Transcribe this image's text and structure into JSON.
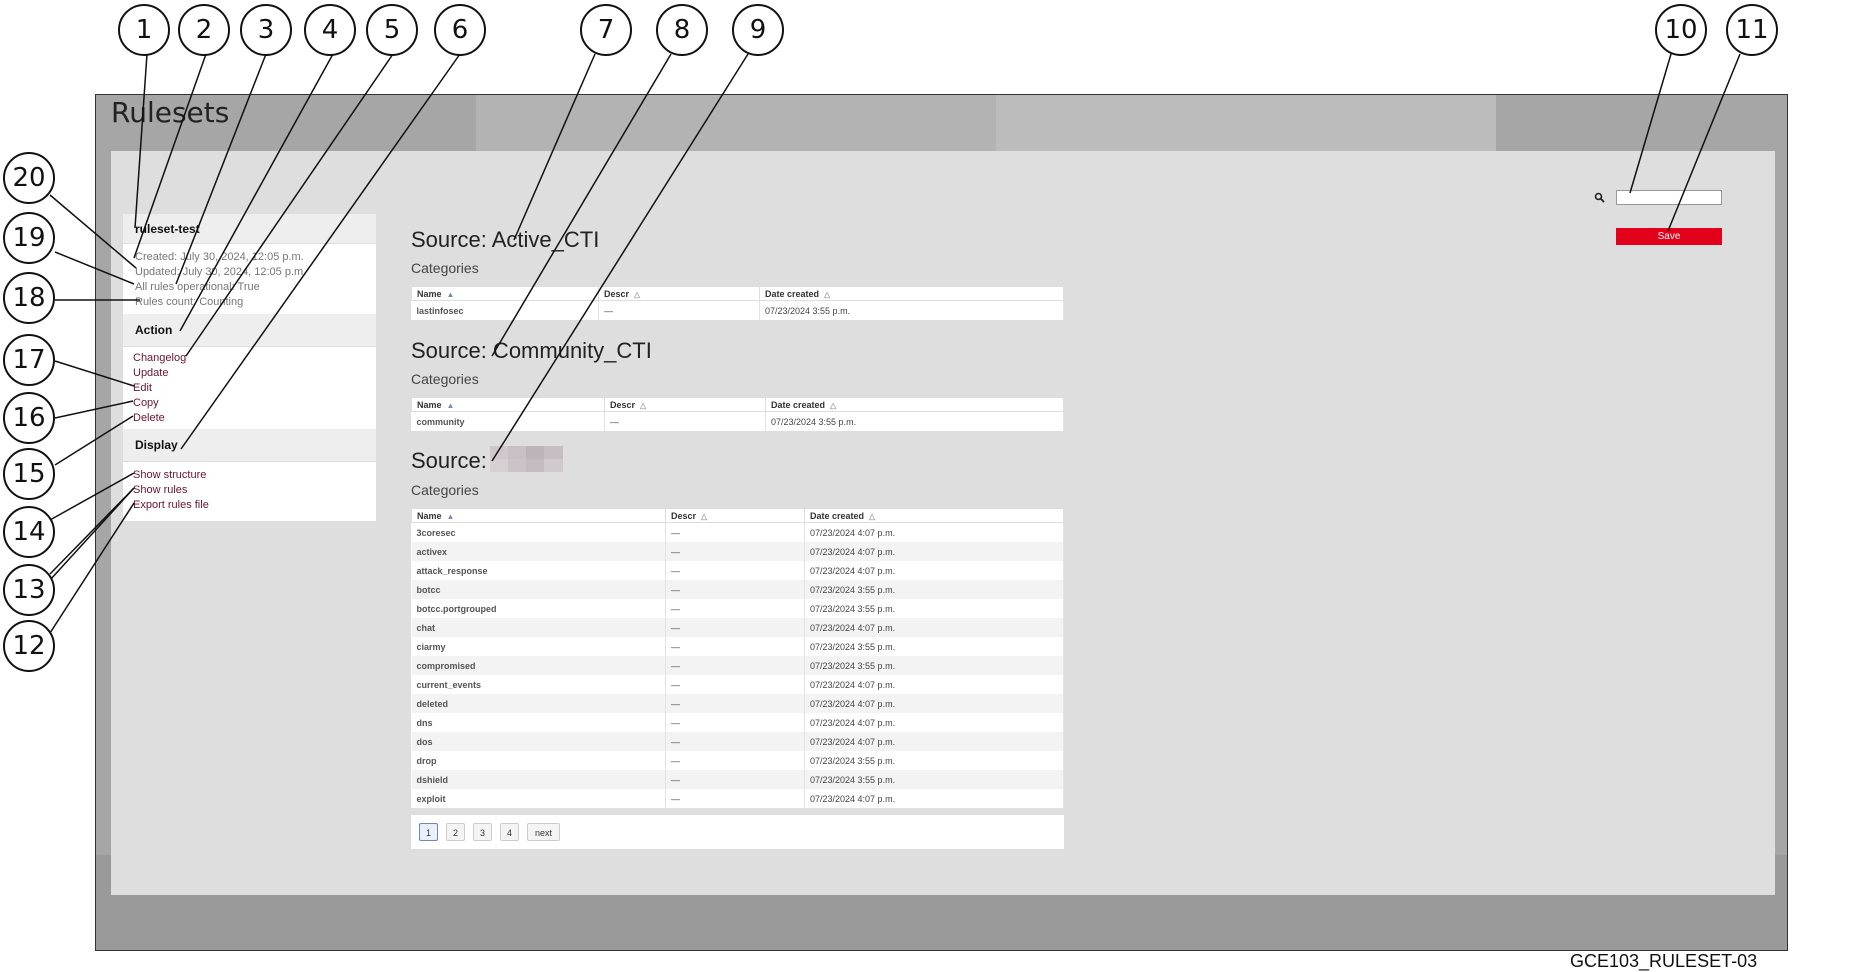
{
  "page_title": "Rulesets",
  "document_id": "GCE103_RULESET-03",
  "callouts": [
    "1",
    "2",
    "3",
    "4",
    "5",
    "6",
    "7",
    "8",
    "9",
    "10",
    "11",
    "20",
    "19",
    "18",
    "17",
    "16",
    "15",
    "14",
    "13",
    "12"
  ],
  "sidebar": {
    "ruleset_name": "ruleset-test",
    "created": "Created: July 30, 2024, 12:05 p.m.",
    "updated": "Updated: July 30, 2024, 12:05 p.m.",
    "operational": "All rules operational: True",
    "rules_count": "Rules count: Counting",
    "action_header": "Action",
    "actions": [
      "Changelog",
      "Update",
      "Edit",
      "Copy",
      "Delete"
    ],
    "display_header": "Display",
    "display_links": [
      "Show structure",
      "Show rules",
      "Export rules file"
    ]
  },
  "search": {
    "placeholder": ""
  },
  "save_label": "Save",
  "columns": [
    "Name",
    "Descr",
    "Date created"
  ],
  "categories_label": "Categories",
  "sources": [
    {
      "title": "Source: Active_CTI",
      "rows": [
        {
          "name": "lastinfosec",
          "descr": "—",
          "date": "07/23/2024 3:55 p.m."
        }
      ]
    },
    {
      "title": "Source: Community_CTI",
      "rows": [
        {
          "name": "community",
          "descr": "—",
          "date": "07/23/2024 3:55 p.m."
        }
      ]
    },
    {
      "title": "Source:",
      "rows": [
        {
          "name": "3coresec",
          "descr": "—",
          "date": "07/23/2024 4:07 p.m."
        },
        {
          "name": "activex",
          "descr": "—",
          "date": "07/23/2024 4:07 p.m."
        },
        {
          "name": "attack_response",
          "descr": "—",
          "date": "07/23/2024 4:07 p.m."
        },
        {
          "name": "botcc",
          "descr": "—",
          "date": "07/23/2024 3:55 p.m."
        },
        {
          "name": "botcc.portgrouped",
          "descr": "—",
          "date": "07/23/2024 3:55 p.m."
        },
        {
          "name": "chat",
          "descr": "—",
          "date": "07/23/2024 4:07 p.m."
        },
        {
          "name": "ciarmy",
          "descr": "—",
          "date": "07/23/2024 3:55 p.m."
        },
        {
          "name": "compromised",
          "descr": "—",
          "date": "07/23/2024 3:55 p.m."
        },
        {
          "name": "current_events",
          "descr": "—",
          "date": "07/23/2024 4:07 p.m."
        },
        {
          "name": "deleted",
          "descr": "—",
          "date": "07/23/2024 4:07 p.m."
        },
        {
          "name": "dns",
          "descr": "—",
          "date": "07/23/2024 4:07 p.m."
        },
        {
          "name": "dos",
          "descr": "—",
          "date": "07/23/2024 4:07 p.m."
        },
        {
          "name": "drop",
          "descr": "—",
          "date": "07/23/2024 3:55 p.m."
        },
        {
          "name": "dshield",
          "descr": "—",
          "date": "07/23/2024 3:55 p.m."
        },
        {
          "name": "exploit",
          "descr": "—",
          "date": "07/23/2024 4:07 p.m."
        }
      ]
    }
  ],
  "pagination": {
    "pages": [
      "1",
      "2",
      "3",
      "4"
    ],
    "next": "next",
    "current": "1"
  },
  "colors": {
    "accent": "#e2001a",
    "link": "#6b1430"
  }
}
